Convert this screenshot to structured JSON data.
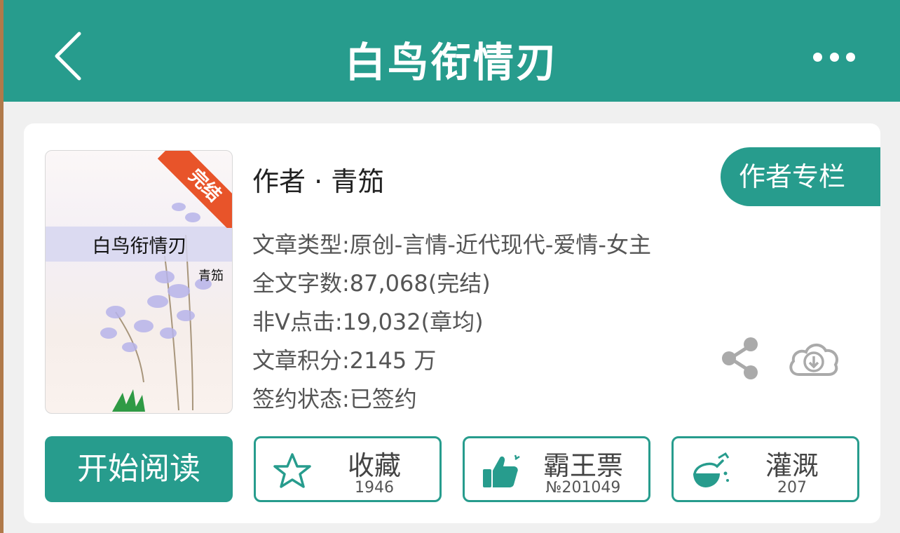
{
  "header": {
    "title": "白鸟衔情刃"
  },
  "colors": {
    "brand": "#279c8d",
    "badge": "#e8542a"
  },
  "book": {
    "cover_title": "白鸟衔情刃",
    "cover_author": "青笳",
    "status_badge": "完结",
    "author_line": "作者 · 青笳",
    "author_column_label": "作者专栏",
    "info": {
      "type": "文章类型:原创-言情-近代现代-爱情-女主",
      "word_count": "全文字数:87,068(完结)",
      "clicks": "非Ⅴ点击:19,032(章均)",
      "score": "文章积分:2145 万",
      "contract": "签约状态:已签约"
    }
  },
  "actions": {
    "read_label": "开始阅读",
    "favorite": {
      "label": "收藏",
      "count": "1946",
      "icon": "star-icon"
    },
    "vote": {
      "label": "霸王票",
      "count": "№201049",
      "icon": "thumbs-up-icon"
    },
    "irrigate": {
      "label": "灌溉",
      "count": "207",
      "icon": "flask-icon"
    }
  },
  "icons": [
    "back-chevron-icon",
    "more-dots-icon",
    "share-icon",
    "cloud-download-icon"
  ]
}
